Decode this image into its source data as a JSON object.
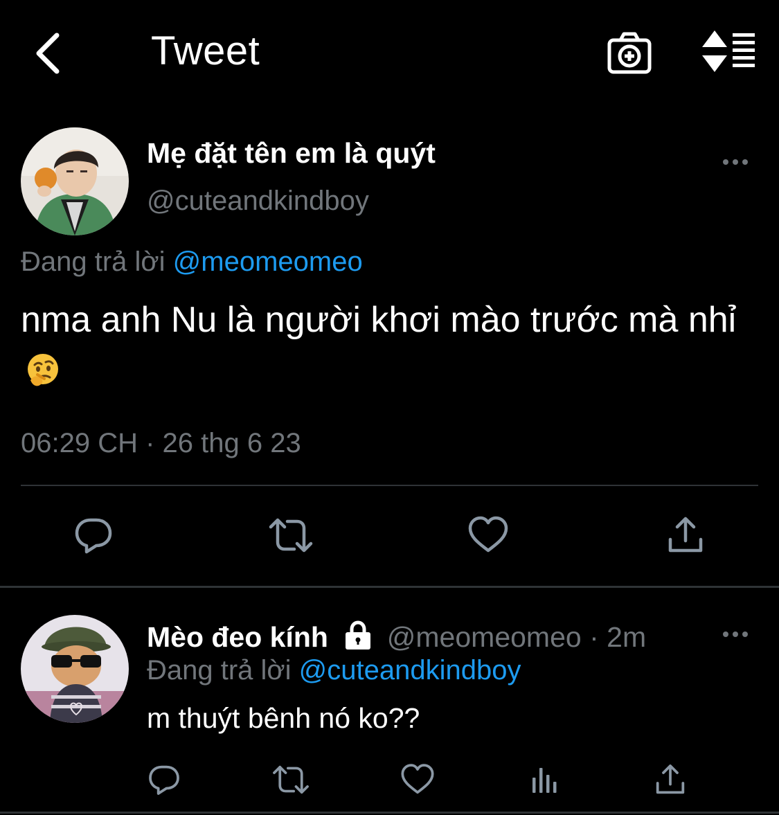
{
  "header": {
    "title": "Tweet",
    "back_icon": "chevron-left-icon",
    "camera_icon": "camera-add-icon",
    "sort_icon": "sort-list-icon"
  },
  "main_tweet": {
    "display_name": "Mẹ đặt tên em là quýt",
    "handle": "@cuteandkindboy",
    "replying_to_label": "Đang trả lời",
    "replying_to_handle": "@meomeomeo",
    "text": "nma anh Nu là người khơi mào trước mà nhỉ",
    "emoji": "thinking-face-emoji",
    "timestamp": "06:29 CH · 26 thg 6 23",
    "actions": [
      "reply-icon",
      "retweet-icon",
      "like-icon",
      "share-icon"
    ]
  },
  "reply_tweet": {
    "display_name": "Mèo đeo kính",
    "protected_icon": "lock-icon",
    "handle": "@meomeomeo",
    "separator": "·",
    "time": "2m",
    "replying_to_label": "Đang trả lời",
    "replying_to_handle": "@cuteandkindboy",
    "text": "m thuýt bênh nó ko??",
    "actions": [
      "reply-icon",
      "retweet-icon",
      "like-icon",
      "views-icon",
      "share-icon"
    ]
  },
  "colors": {
    "background": "#000000",
    "text_primary": "#ffffff",
    "text_secondary": "#71767b",
    "accent": "#1d9bf0",
    "divider": "#2f3336"
  }
}
